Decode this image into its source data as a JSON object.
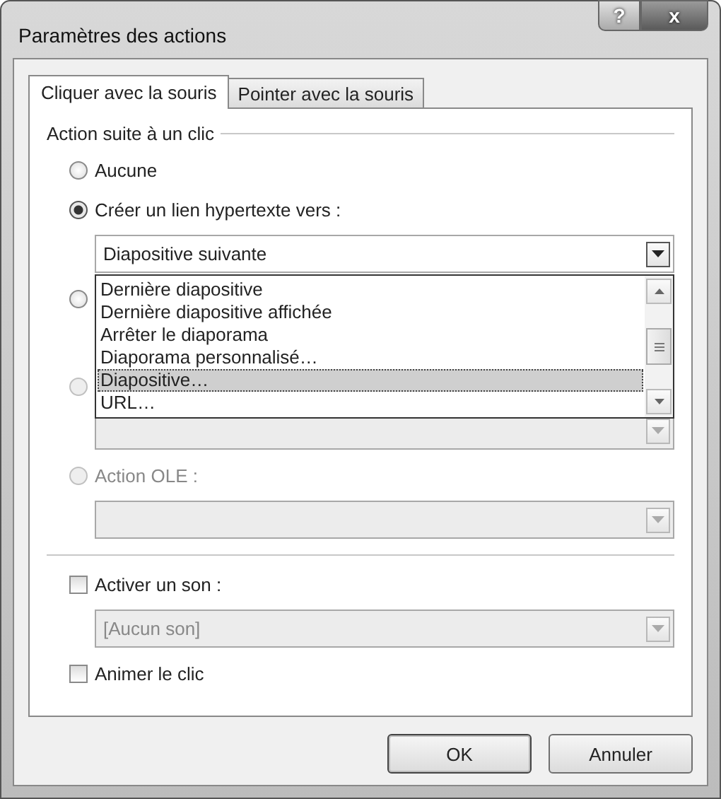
{
  "window": {
    "title": "Paramètres des actions",
    "controls": [
      {
        "kind": "help",
        "label": "?"
      },
      {
        "kind": "close",
        "label": "x"
      }
    ]
  },
  "tabs": [
    {
      "label": "Cliquer avec la souris",
      "selected": true
    },
    {
      "label": "Pointer avec la souris",
      "selected": false
    }
  ],
  "group": {
    "label": "Action suite à un clic"
  },
  "actions": [
    {
      "kind": "radio",
      "label": "Aucune",
      "selected": false,
      "disabled": false
    },
    {
      "kind": "radio",
      "label": "Créer un lien hypertexte vers :",
      "selected": true,
      "disabled": false
    },
    {
      "kind": "combo",
      "value": "Diapositive suivante",
      "disabled": false,
      "open": true
    },
    {
      "kind": "radio",
      "selected": false,
      "disabled": false
    },
    {
      "kind": "field"
    },
    {
      "kind": "radio",
      "selected": false,
      "disabled": true
    },
    {
      "kind": "combo",
      "disabled": true
    },
    {
      "kind": "radio",
      "label": "Action OLE :",
      "selected": false,
      "disabled": true
    },
    {
      "kind": "combo",
      "disabled": true
    }
  ],
  "dropdown": {
    "items": [
      {
        "label": "Dernière diapositive",
        "selected": false
      },
      {
        "label": "Dernière diapositive affichée",
        "selected": false
      },
      {
        "label": "Arrêter le diaporama",
        "selected": false
      },
      {
        "label": "Diaporama personnalisé…",
        "selected": false
      },
      {
        "label": "Diapositive…",
        "selected": true
      },
      {
        "label": "URL…",
        "selected": false
      }
    ]
  },
  "options": [
    {
      "kind": "checkbox",
      "label": "Activer un son :",
      "checked": false
    },
    {
      "kind": "combo",
      "value": "[Aucun son]",
      "disabled": true
    },
    {
      "kind": "checkbox",
      "label": "Animer le clic",
      "checked": false
    }
  ],
  "buttons": [
    {
      "label": "OK",
      "default": true
    },
    {
      "label": "Annuler",
      "default": false
    }
  ]
}
